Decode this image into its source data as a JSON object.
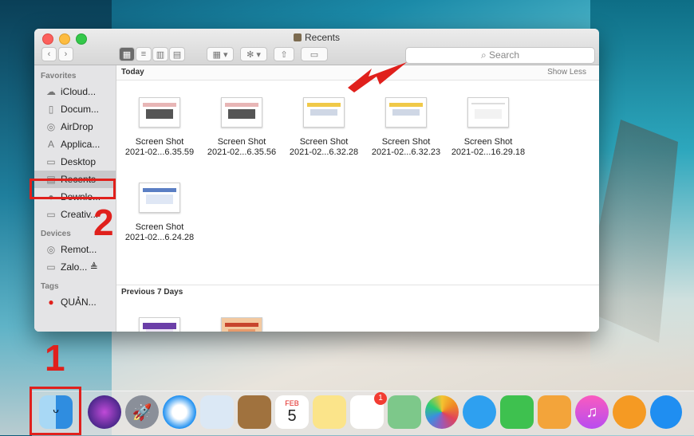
{
  "window": {
    "title": "Recents",
    "search_placeholder": "Search",
    "show_less": "Show Less"
  },
  "sidebar": {
    "favorites_header": "Favorites",
    "favorites": [
      {
        "label": "iCloud...",
        "icon": "cloud-icon"
      },
      {
        "label": "Docum...",
        "icon": "document-icon"
      },
      {
        "label": "AirDrop",
        "icon": "airdrop-icon"
      },
      {
        "label": "Applica...",
        "icon": "applications-icon"
      },
      {
        "label": "Desktop",
        "icon": "desktop-icon"
      },
      {
        "label": "Recents",
        "icon": "recents-icon"
      },
      {
        "label": "Downlo...",
        "icon": "downloads-icon"
      },
      {
        "label": "Creativ...",
        "icon": "folder-icon"
      }
    ],
    "devices_header": "Devices",
    "devices": [
      {
        "label": "Remot...",
        "icon": "disc-icon"
      },
      {
        "label": "Zalo... ≜",
        "icon": "drive-icon"
      }
    ],
    "tags_header": "Tags",
    "tags": [
      {
        "label": "QUẢN...",
        "color": "#e0201c"
      }
    ]
  },
  "sections": {
    "today": "Today",
    "previous": "Previous 7 Days"
  },
  "files_today": [
    {
      "name": "Screen Shot",
      "date": "2021-02...6.35.59"
    },
    {
      "name": "Screen Shot",
      "date": "2021-02...6.35.56"
    },
    {
      "name": "Screen Shot",
      "date": "2021-02...6.32.28"
    },
    {
      "name": "Screen Shot",
      "date": "2021-02...6.32.23"
    },
    {
      "name": "Screen Shot",
      "date": "2021-02...16.29.18"
    },
    {
      "name": "Screen Shot",
      "date": "2021-02...6.24.28"
    }
  ],
  "annotations": {
    "step1": "1",
    "step2": "2",
    "highlight_color": "#e0201c"
  },
  "dock": {
    "calendar_month": "FEB",
    "calendar_day": "5",
    "reminders_badge": "1"
  }
}
